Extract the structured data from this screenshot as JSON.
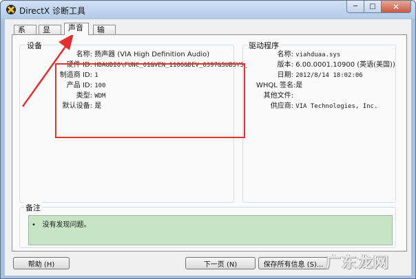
{
  "window": {
    "title": "DirectX 诊断工具"
  },
  "tabs": [
    {
      "label": "系统",
      "active": false
    },
    {
      "label": "显示",
      "active": false
    },
    {
      "label": "声音",
      "active": true
    },
    {
      "label": "输入",
      "active": false
    }
  ],
  "device": {
    "group_title": "设备",
    "rows": [
      {
        "key": "名称:",
        "value": "扬声器 (VIA High Definition Audio)"
      },
      {
        "key": "硬件 ID:",
        "value": "HDAUDIO\\FUNC_01&VEN_1106&DEV_0397&SUBSYS_"
      },
      {
        "key": "制造商 ID:",
        "value": "1"
      },
      {
        "key": "产品 ID:",
        "value": "100"
      },
      {
        "key": "类型:",
        "value": "WDM"
      },
      {
        "key": "默认设备:",
        "value": "是"
      }
    ]
  },
  "driver": {
    "group_title": "驱动程序",
    "rows": [
      {
        "key": "名称:",
        "value": "viahduaa.sys"
      },
      {
        "key": "版本:",
        "value": "6.00.0001.10900 (英语(美国))"
      },
      {
        "key": "日期:",
        "value": "2012/8/14 18:02:06"
      },
      {
        "key": "WHQL 签名:",
        "value": "是"
      },
      {
        "key": "其他文件:",
        "value": ""
      },
      {
        "key": "供应商:",
        "value": "VIA Technologies, Inc."
      }
    ]
  },
  "notes": {
    "group_title": "备注",
    "items": [
      "没有发现问题。"
    ]
  },
  "buttons": {
    "help": "帮助 (H)",
    "next_page": "下一页 (N)",
    "save_all": "保存所有信息 (S)..."
  },
  "watermark": "广东龙网",
  "colors": {
    "annotation": "#e03030",
    "notes_background": "#c7e4c4"
  }
}
